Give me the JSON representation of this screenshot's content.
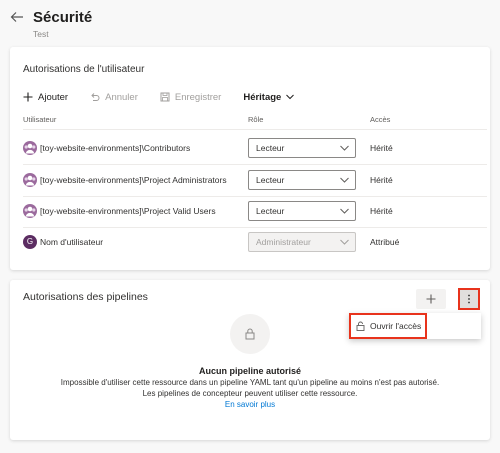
{
  "header": {
    "title": "Sécurité",
    "subtitle": "Test"
  },
  "user_permissions": {
    "title": "Autorisations de l'utilisateur",
    "toolbar": {
      "add_label": "Ajouter",
      "cancel_label": "Annuler",
      "save_label": "Enregistrer",
      "inheritance_label": "Héritage"
    },
    "columns": {
      "user": "Utilisateur",
      "role": "Rôle",
      "access": "Accès"
    },
    "rows": [
      {
        "user": "[toy-website-environments]\\Contributors",
        "role": "Lecteur",
        "access": "Hérité",
        "avatar": "group-icon"
      },
      {
        "user": "[toy-website-environments]\\Project Administrators",
        "role": "Lecteur",
        "access": "Hérité",
        "avatar": "group-icon"
      },
      {
        "user": "[toy-website-environments]\\Project Valid Users",
        "role": "Lecteur",
        "access": "Hérité",
        "avatar": "group-icon"
      },
      {
        "user": "Nom d'utilisateur",
        "role": "Administrateur",
        "access": "Attribué",
        "avatar_letter": "G"
      }
    ]
  },
  "pipeline_permissions": {
    "title": "Autorisations des pipelines",
    "menu": {
      "open_access_label": "Ouvrir l'accès"
    },
    "empty_state": {
      "title": "Aucun pipeline autorisé",
      "line1": "Impossible d'utiliser cette ressource dans un pipeline YAML tant qu'un pipeline au moins n'est pas autorisé.",
      "line2": "Les pipelines de concepteur peuvent utiliser cette ressource.",
      "link": "En savoir plus"
    }
  },
  "colors": {
    "accent": "#0078d4",
    "highlight": "#e8331c",
    "avatar_group": "#9b6a9d",
    "avatar_user": "#5c2d62"
  }
}
